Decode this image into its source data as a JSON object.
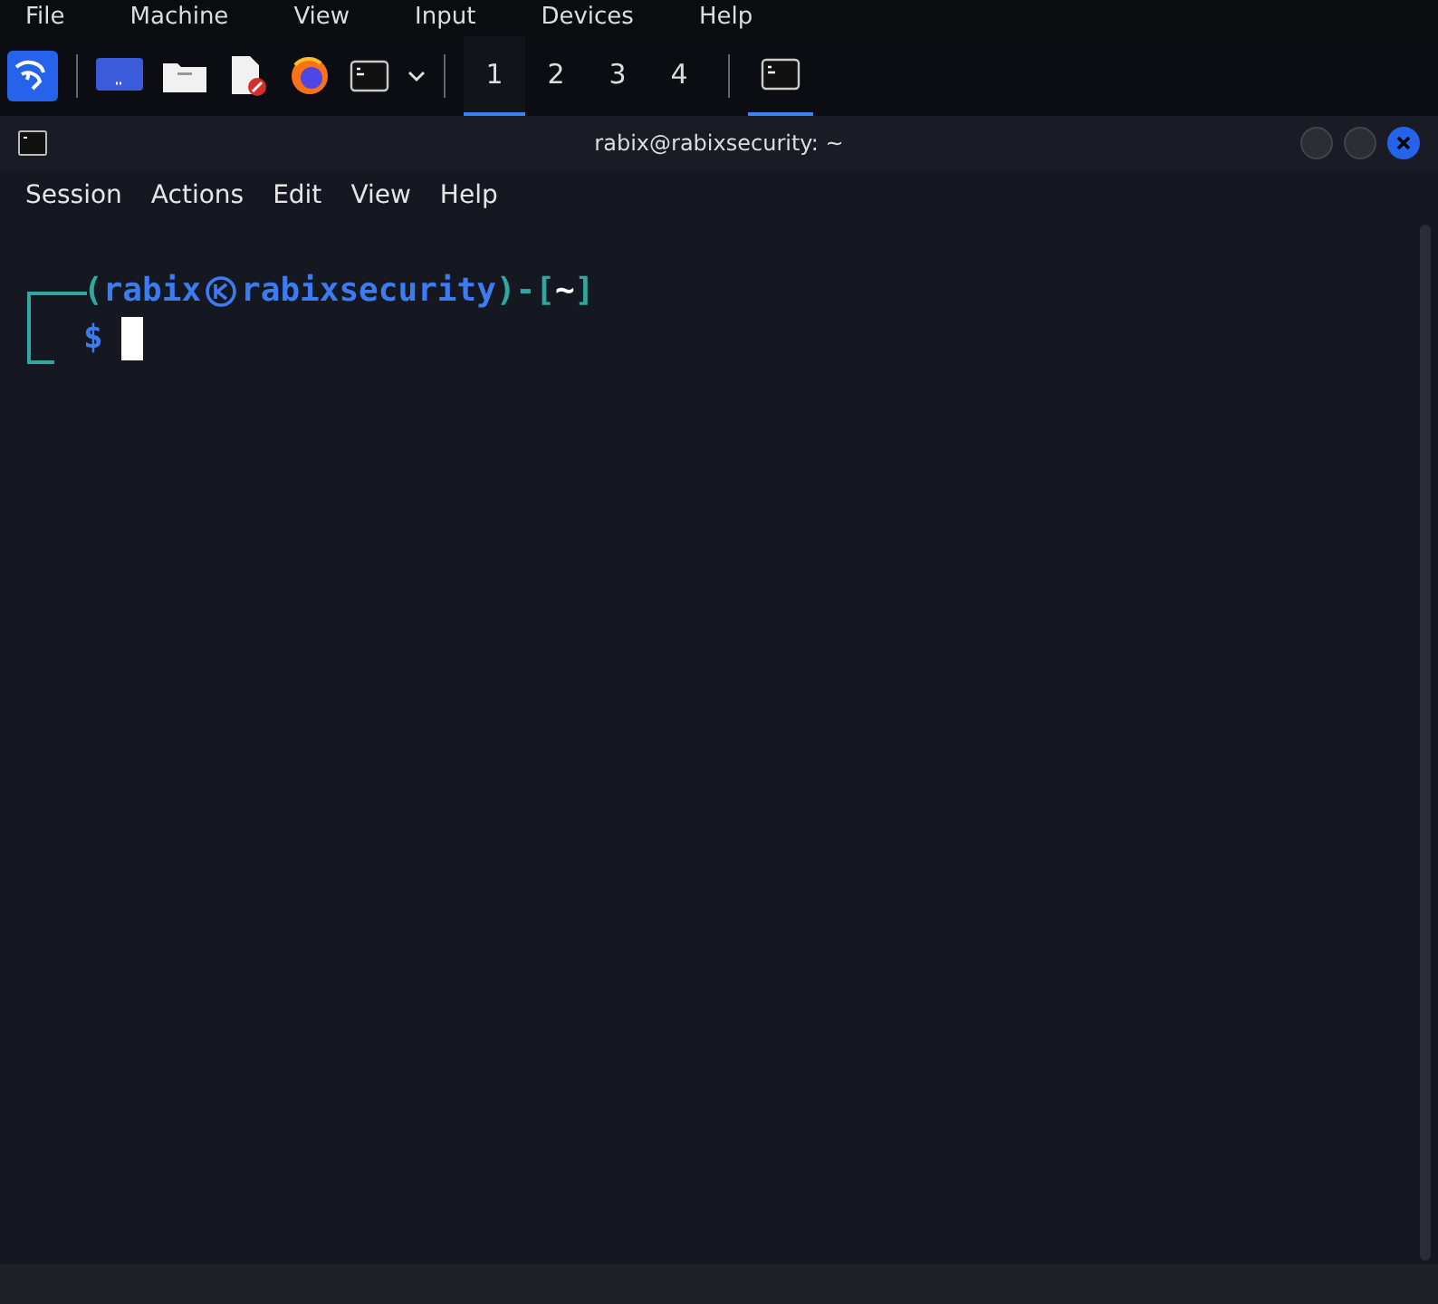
{
  "host_menu": [
    "File",
    "Machine",
    "View",
    "Input",
    "Devices",
    "Help"
  ],
  "taskbar": {
    "workspaces": [
      {
        "label": "1",
        "selected": true
      },
      {
        "label": "2",
        "selected": false
      },
      {
        "label": "3",
        "selected": false
      },
      {
        "label": "4",
        "selected": false
      }
    ],
    "tasks": [
      {
        "kind": "terminal",
        "selected": true
      }
    ]
  },
  "window": {
    "title": "rabix@rabixsecurity: ~"
  },
  "menu": [
    "Session",
    "Actions",
    "Edit",
    "View",
    "Help"
  ],
  "terminal": {
    "open": "(",
    "user": "rabix",
    "host": "rabixsecurity",
    "mid": ")-[",
    "cwd": "~",
    "close": "]",
    "prompt": "$"
  }
}
